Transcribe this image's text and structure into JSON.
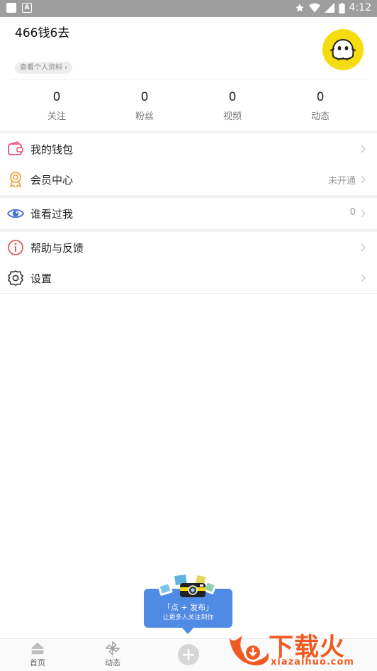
{
  "status_bar": {
    "time": "4:12",
    "notification_badge": "A"
  },
  "profile": {
    "username": "466钱6去",
    "view_profile_label": "查看个人资料 ›",
    "avatar_color": "#f5dc10"
  },
  "stats": [
    {
      "value": "0",
      "label": "关注"
    },
    {
      "value": "0",
      "label": "粉丝"
    },
    {
      "value": "0",
      "label": "视频"
    },
    {
      "value": "0",
      "label": "动态"
    }
  ],
  "menu": {
    "wallet": {
      "label": "我的钱包",
      "icon": "wallet-icon"
    },
    "vip": {
      "label": "会员中心",
      "value": "未开通",
      "icon": "medal-icon"
    },
    "visitors": {
      "label": "谁看过我",
      "value": "0",
      "icon": "eye-icon"
    },
    "help": {
      "label": "帮助与反馈",
      "icon": "info-icon"
    },
    "settings": {
      "label": "设置",
      "icon": "gear-icon"
    }
  },
  "tooltip": {
    "title": "「点 + 发布」",
    "subtitle": "让更多人关注到你"
  },
  "bottom_nav": [
    {
      "label": "首页",
      "icon": "home-icon"
    },
    {
      "label": "动态",
      "icon": "pinwheel-icon"
    },
    {
      "label": "",
      "icon": "plus-icon"
    }
  ],
  "watermark": {
    "text": "下载火",
    "url": "xiazaihuo.com"
  },
  "colors": {
    "accent_blue": "#4f8ae5",
    "watermark_orange": "#f05a22",
    "wallet_pink": "#e8517a",
    "vip_orange": "#f2a33a",
    "eye_blue": "#3d6fd6",
    "info_red": "#e65a5a"
  }
}
